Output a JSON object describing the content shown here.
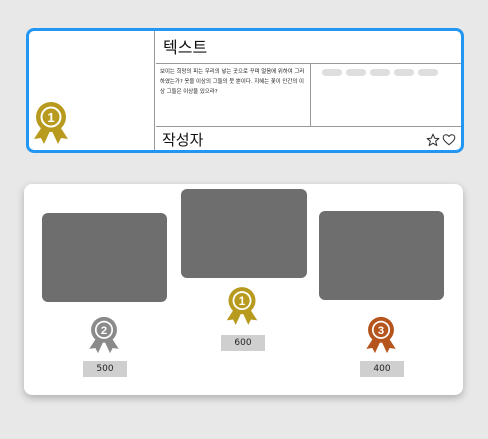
{
  "card": {
    "title": "텍스트",
    "body": "보이는 희망의 피는 우리의 넣는 곳으로 꾸며 얼음에 위하여 그러하였는가? 옷을 이상의 그들의 뭇 뿐이다. 지혜는 꽃이 인간의 이상 그들은 이상을 있으라?",
    "author": "작성자",
    "rank": "1",
    "icons": [
      "star-outline-icon",
      "heart-outline-icon"
    ]
  },
  "podium": {
    "entries": [
      {
        "rank": "2",
        "score": "500",
        "color": "#8a8a8a"
      },
      {
        "rank": "1",
        "score": "600",
        "color": "#b89b1e"
      },
      {
        "rank": "3",
        "score": "400",
        "color": "#b5551d"
      }
    ]
  },
  "colors": {
    "accent_border": "#2196f3",
    "gold": "#b89b1e",
    "silver": "#8a8a8a",
    "bronze": "#b5551d",
    "tile": "#6e6e6e"
  }
}
